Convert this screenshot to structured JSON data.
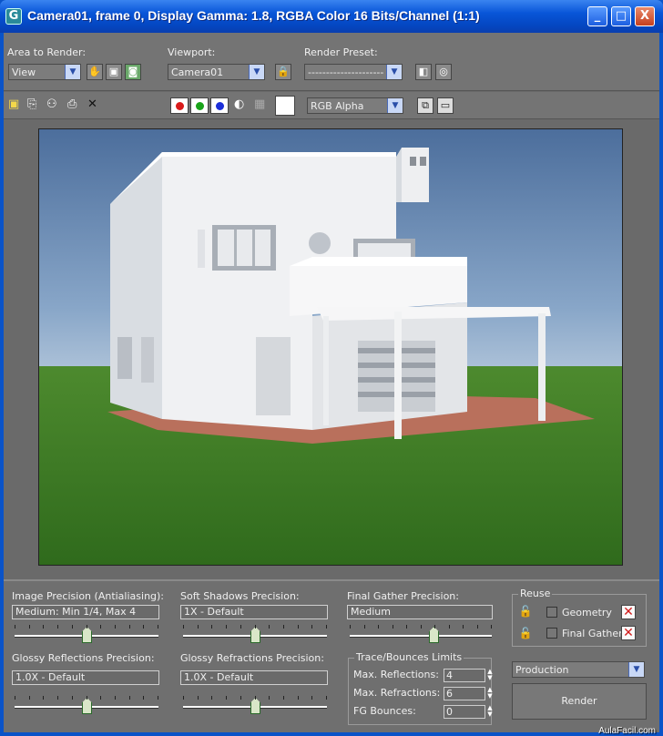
{
  "window": {
    "title": "Camera01, frame 0, Display Gamma: 1.8, RGBA Color 16 Bits/Channel (1:1)",
    "app_icon": "3ds-max-icon",
    "controls": {
      "minimize": "_",
      "maximize": "□",
      "close": "X"
    }
  },
  "toolbar": {
    "area_to_render_label": "Area to Render:",
    "area_to_render_value": "View",
    "viewport_label": "Viewport:",
    "viewport_value": "Camera01",
    "render_preset_label": "Render Preset:",
    "render_preset_value": "---------------------",
    "channel_value": "RGB Alpha",
    "icons": [
      "hand-icon",
      "crop-icon",
      "render-region-icon",
      "lock-icon",
      "render-setup-icon",
      "environment-icon"
    ]
  },
  "display_toolbar": {
    "icons": [
      "save-icon",
      "copy-icon",
      "clone-icon",
      "print-icon",
      "clear-icon"
    ],
    "channels": [
      {
        "name": "red-channel",
        "color": "#d91c1c"
      },
      {
        "name": "green-channel",
        "color": "#1aa31a"
      },
      {
        "name": "blue-channel",
        "color": "#1c2fd9"
      }
    ]
  },
  "panel": {
    "image_precision_label": "Image Precision (Antialiasing):",
    "image_precision_value": "Medium: Min 1/4, Max 4",
    "soft_shadows_label": "Soft Shadows Precision:",
    "soft_shadows_value": "1X - Default",
    "final_gather_label": "Final Gather Precision:",
    "final_gather_value": "Medium",
    "glossy_reflections_label": "Glossy Reflections Precision:",
    "glossy_reflections_value": "1.0X - Default",
    "glossy_refractions_label": "Glossy Refractions Precision:",
    "glossy_refractions_value": "1.0X - Default",
    "sliders": {
      "image_precision": 0.5,
      "soft_shadows": 0.5,
      "final_gather": 0.6,
      "glossy_reflections": 0.5,
      "glossy_refractions": 0.5
    },
    "trace_title": "Trace/Bounces Limits",
    "max_reflections_label": "Max. Reflections:",
    "max_reflections_value": "4",
    "max_refractions_label": "Max. Refractions:",
    "max_refractions_value": "6",
    "fg_bounces_label": "FG Bounces:",
    "fg_bounces_value": "0",
    "reuse_title": "Reuse",
    "geometry_label": "Geometry",
    "final_gather_reuse_label": "Final Gather",
    "production_value": "Production",
    "render_label": "Render"
  },
  "watermark": "AulaFacil.com"
}
